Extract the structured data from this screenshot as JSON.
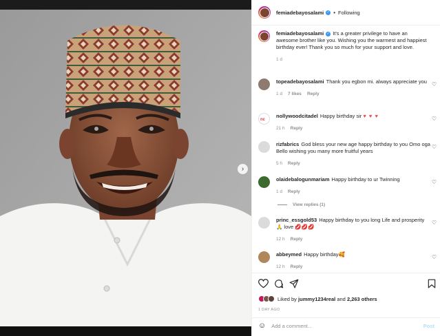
{
  "post": {
    "author": "femiadebayosalami",
    "follow_status": "Following",
    "next_icon": "chevron-right-icon"
  },
  "caption": {
    "author": "femiadebayosalami",
    "text": "It's a greater privilege to have an awesome brother like you. Wishing you the warmest and happiest birthday ever! Thank you so much for your support and love.",
    "time": "1 d"
  },
  "comments": [
    {
      "user": "topeadebayosalami",
      "text": "Thank you egbon mi. always appreciate you",
      "time": "1 d",
      "likes": "7 likes",
      "reply": "Reply"
    },
    {
      "user": "nollywoodcitadel",
      "text": "Happy birthday sir",
      "emoji": "♥ ♥ ♥",
      "time": "21 h",
      "reply": "Reply"
    },
    {
      "user": "rizfabrics",
      "text": "God bless your new age happy birthday to you Omo oga Bello wishing you many more fruitful years",
      "time": "5 h",
      "reply": "Reply"
    },
    {
      "user": "olaidebalogunmariam",
      "text": "Happy birthday to ur Twinning",
      "time": "1 d",
      "reply": "Reply",
      "view_replies": "View replies (1)"
    },
    {
      "user": "princ_essgold53",
      "text": "Happy birthday to you long Life and prosperity 🙏 love",
      "emoji": "💋💋💋",
      "time": "12 h",
      "reply": "Reply"
    },
    {
      "user": "abbeymed",
      "text": "Happy birthday",
      "emoji": "🥰",
      "time": "12 h",
      "reply": "Reply"
    }
  ],
  "likes": {
    "prefix": "Liked by",
    "user": "jummy1234real",
    "joiner": "and",
    "others": "2,263 others"
  },
  "timestamp": "1 DAY AGO",
  "add_comment": {
    "placeholder": "Add a comment...",
    "post_label": "Post"
  },
  "colors": {
    "link_blue": "#3897f0",
    "post_disabled": "#b2dffc",
    "heart_red": "#ed4956"
  }
}
